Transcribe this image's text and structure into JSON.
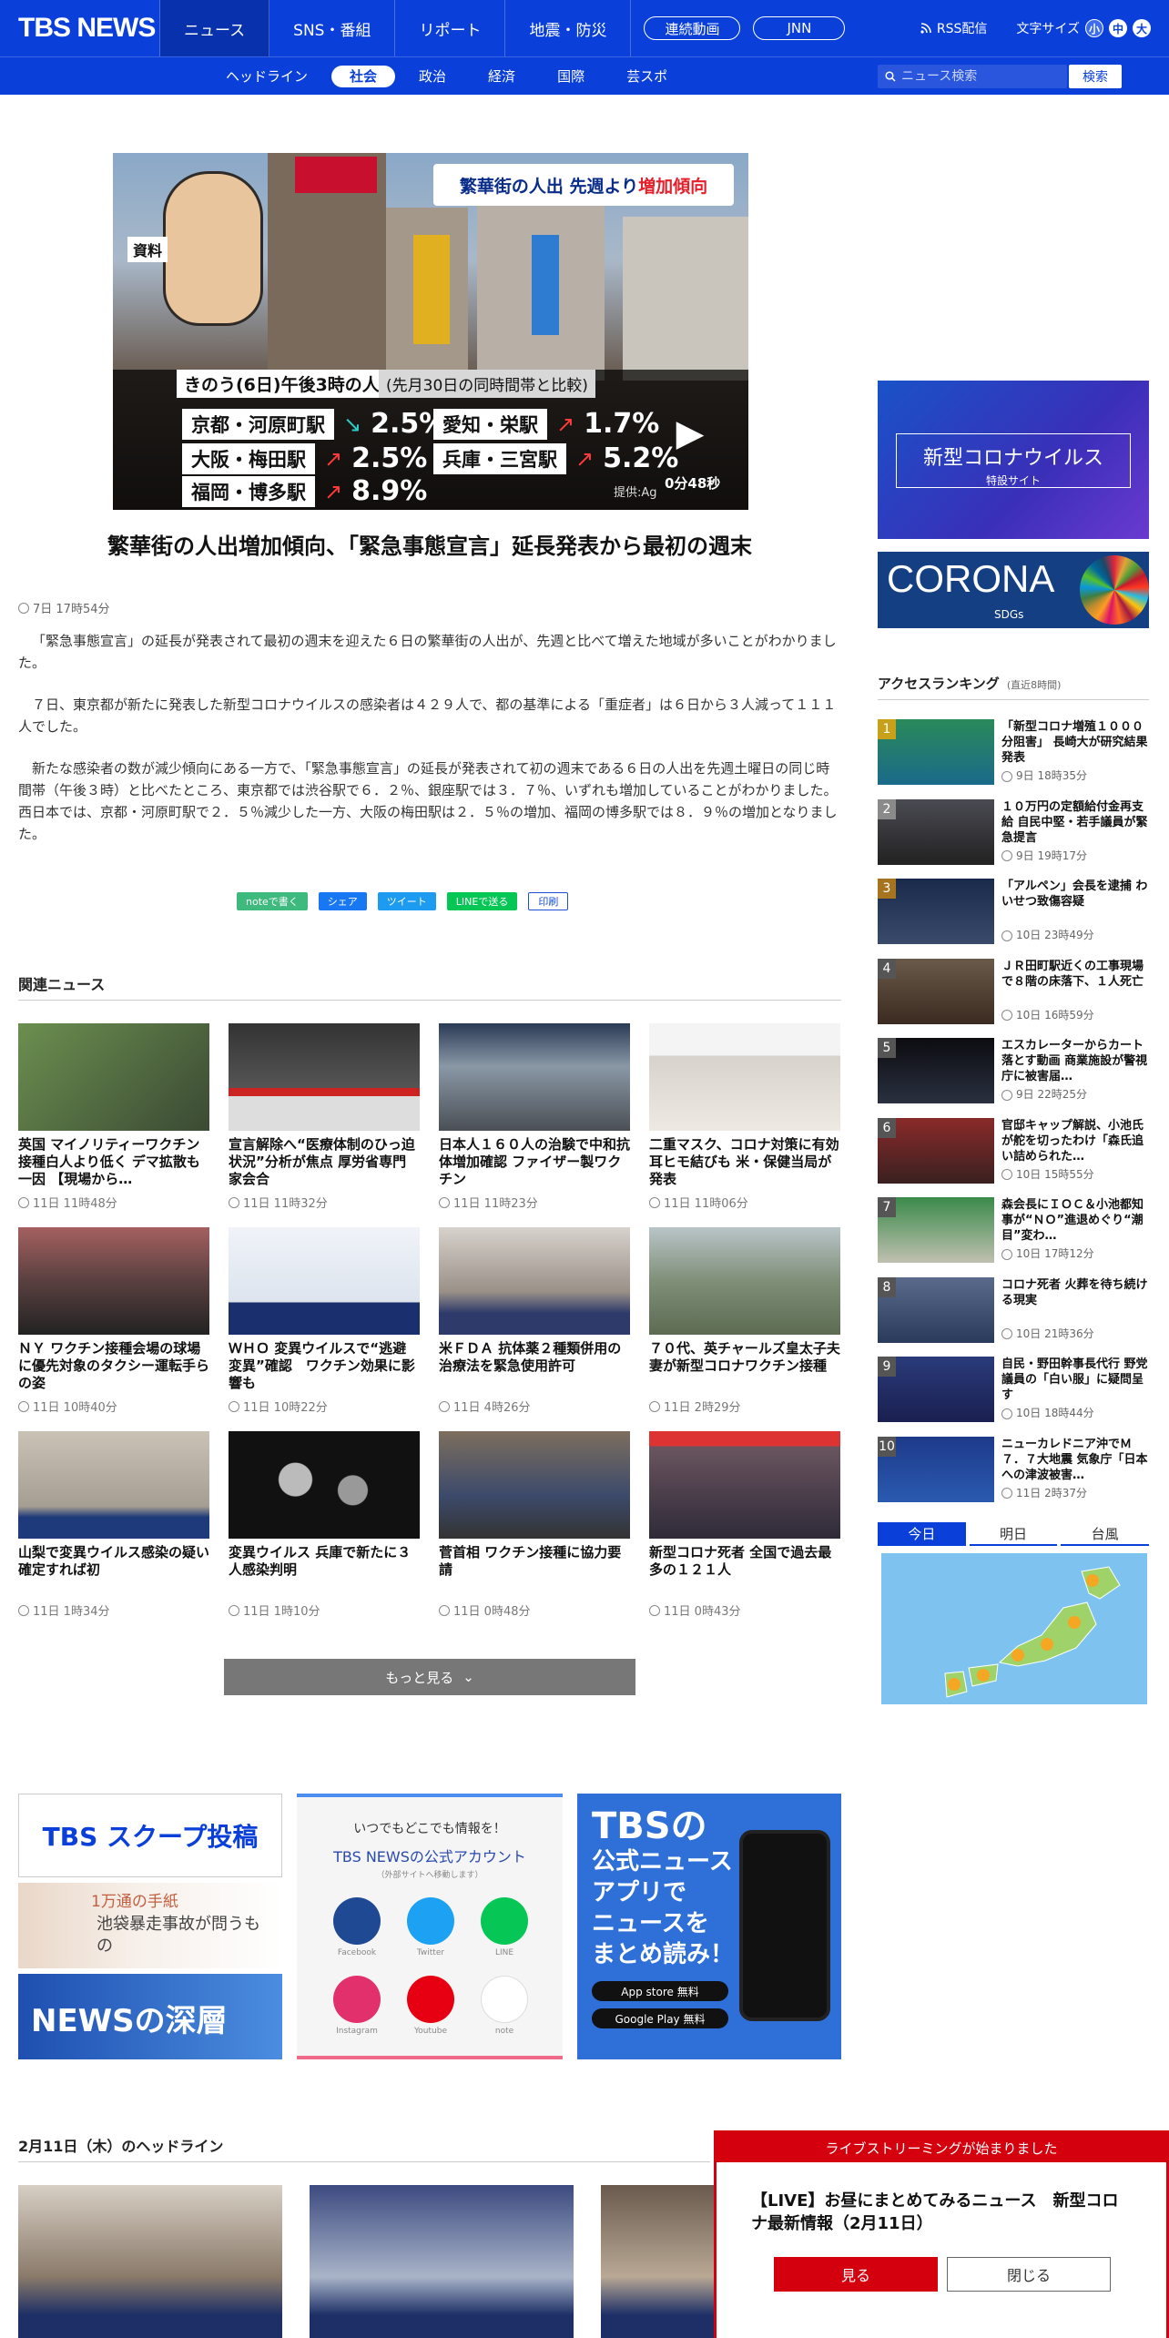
{
  "header": {
    "logo": "TBS NEWS",
    "nav": [
      "ニュース",
      "SNS・番組",
      "リポート",
      "地震・防災"
    ],
    "pills": [
      "連続動画",
      "JNN"
    ],
    "rss": "RSS配信",
    "font_size_label": "文字サイズ",
    "font_sizes": [
      "小",
      "中",
      "大"
    ]
  },
  "subnav": {
    "items": [
      "ヘッドライン",
      "社会",
      "政治",
      "経済",
      "国際",
      "芸スポ"
    ],
    "active": "社会",
    "search_placeholder": "ニュース検索",
    "search_button": "検索"
  },
  "video": {
    "tag": "資料",
    "banner_a": "繁華街の人出 先週より",
    "banner_b": "増加傾向",
    "panel_title": "きのう(6日)午後3時の人出",
    "panel_note": "(先月30日の同時間帯と比較)",
    "stats": [
      {
        "station": "京都・河原町駅",
        "arrow": "↘",
        "value": "2.5%",
        "color": "#2ad0c8"
      },
      {
        "station": "愛知・栄駅",
        "arrow": "↗",
        "value": "1.7%",
        "color": "#ff3a3a"
      },
      {
        "station": "大阪・梅田駅",
        "arrow": "↗",
        "value": "2.5%",
        "color": "#ff3a3a"
      },
      {
        "station": "兵庫・三宮駅",
        "arrow": "↗",
        "value": "5.2%",
        "color": "#ff3a3a"
      },
      {
        "station": "福岡・博多駅",
        "arrow": "↗",
        "value": "8.9%",
        "color": "#ff3a3a"
      }
    ],
    "duration": "0分48秒",
    "credit": "提供:Ag"
  },
  "article": {
    "title": "繁華街の人出増加傾向、「緊急事態宣言」延長発表から最初の週末",
    "time": "7日 17時54分",
    "paragraphs": [
      "「緊急事態宣言」の延長が発表されて最初の週末を迎えた６日の繁華街の人出が、先週と比べて増えた地域が多いことがわかりました。",
      "７日、東京都が新たに発表した新型コロナウイルスの感染者は４２９人で、都の基準による「重症者」は６日から３人減って１１１人でした。",
      "新たな感染者の数が減少傾向にある一方で、「緊急事態宣言」の延長が発表されて初の週末である６日の人出を先週土曜日の同じ時間帯（午後３時）と比べたところ、東京都では渋谷駅で６．２％、銀座駅では３．７％、いずれも増加していることがわかりました。西日本では、京都・河原町駅で２．５％減少した一方、大阪の梅田駅は２．５％の増加、福岡の博多駅では８．９％の増加となりました。"
    ],
    "share": [
      "noteで書く",
      "シェア",
      "ツイート",
      "LINEで送る",
      "印刷"
    ]
  },
  "related": {
    "title": "関連ニュース",
    "items": [
      {
        "title": "英国 マイノリティーワクチン接種白人より低く デマ拡散も一因 【現場から…",
        "time": "11日 11時48分"
      },
      {
        "title": "宣言解除へ“医療体制のひっ迫状況”分析が焦点 厚労省専門家会合",
        "time": "11日 11時32分"
      },
      {
        "title": "日本人１６０人の治験で中和抗体増加確認 ファイザー製ワクチン",
        "time": "11日 11時23分"
      },
      {
        "title": "二重マスク、コロナ対策に有効 耳ヒモ結びも 米・保健当局が発表",
        "time": "11日 11時06分"
      },
      {
        "title": "ＮＹ ワクチン接種会場の球場に優先対象のタクシー運転手らの姿",
        "time": "11日 10時40分"
      },
      {
        "title": "ＷＨＯ 変異ウイルスで“逃避変異”確認　ワクチン効果に影響も",
        "time": "11日 10時22分"
      },
      {
        "title": "米ＦＤＡ 抗体薬２種類併用の治療法を緊急使用許可",
        "time": "11日 4時26分"
      },
      {
        "title": "７０代、英チャールズ皇太子夫妻が新型コロナワクチン接種",
        "time": "11日 2時29分"
      },
      {
        "title": "山梨で変異ウイルス感染の疑い 確定すれば初",
        "time": "11日 1時34分"
      },
      {
        "title": "変異ウイルス 兵庫で新たに３人感染判明",
        "time": "11日 1時10分"
      },
      {
        "title": "菅首相 ワクチン接種に協力要請",
        "time": "11日 0時48分"
      },
      {
        "title": "新型コロナ死者 全国で過去最多の１２１人",
        "time": "11日 0時43分"
      }
    ],
    "more": "もっと見る"
  },
  "banners": {
    "scoop": "TBS スクープ投稿",
    "scoop_b": "1万通の手紙",
    "scoop_c": "池袋暴走事故が問うもの",
    "deep": "NEWSの深層",
    "sns_head": "いつでもどこでも情報を！",
    "sns_title": "TBS NEWSの公式アカウント",
    "sns_note": "（外部サイトへ移動します）",
    "sns": [
      "Facebook",
      "Twitter",
      "LINE",
      "Instagram",
      "Youtube",
      "note"
    ],
    "app1": "TBSの",
    "app2": "公式ニュース",
    "app3": "アプリで",
    "app4": "ニュースを",
    "app5": "まとめ読み！",
    "app_store": "App store 無料",
    "google_play": "Google Play 無料"
  },
  "sidebar": {
    "corona_title": "新型コロナウイルス",
    "corona_sub": "特設サイト",
    "corona2": "CORONA",
    "corona2_sub": "SDGs",
    "ranking_title": "アクセスランキング",
    "ranking_note": "(直近8時間)",
    "ranking": [
      {
        "title": "「新型コロナ増殖１０００分阻害」 長崎大が研究結果発表",
        "time": "9日 18時35分"
      },
      {
        "title": "１０万円の定額給付金再支給 自民中堅・若手議員が緊急提言",
        "time": "9日 19時17分"
      },
      {
        "title": "「アルペン」会長を逮捕 わいせつ致傷容疑",
        "time": "10日 23時49分"
      },
      {
        "title": "ＪＲ田町駅近くの工事現場で８階の床落下、１人死亡",
        "time": "10日 16時59分"
      },
      {
        "title": "エスカレーターからカート落とす動画 商業施設が警視庁に被害届…",
        "time": "9日 22時25分"
      },
      {
        "title": "官邸キャップ解説、小池氏が舵を切ったわけ「森氏追い詰められた…",
        "time": "10日 15時55分"
      },
      {
        "title": "森会長にＩＯＣ＆小池都知事が“ＮＯ”進退めぐり“潮目”変わ…",
        "time": "10日 17時12分"
      },
      {
        "title": "コロナ死者 火葬を待ち続ける現実",
        "time": "10日 21時36分"
      },
      {
        "title": "自民・野田幹事長代行 野党議員の「白い服」に疑問呈す",
        "time": "10日 18時44分"
      },
      {
        "title": "ニューカレドニア沖でＭ７．７大地震 気象庁「日本への津波被害…",
        "time": "11日 2時37分"
      }
    ],
    "weather_tabs": [
      "今日",
      "明日",
      "台風"
    ]
  },
  "headlines": {
    "title": "2月11日（木）のヘッドライン"
  },
  "popup": {
    "header": "ライブストリーミングが始まりました",
    "message": "【LIVE】お昼にまとめてみるニュース　新型コロナ最新情報（2月11日）",
    "watch": "見る",
    "close": "閉じる"
  }
}
